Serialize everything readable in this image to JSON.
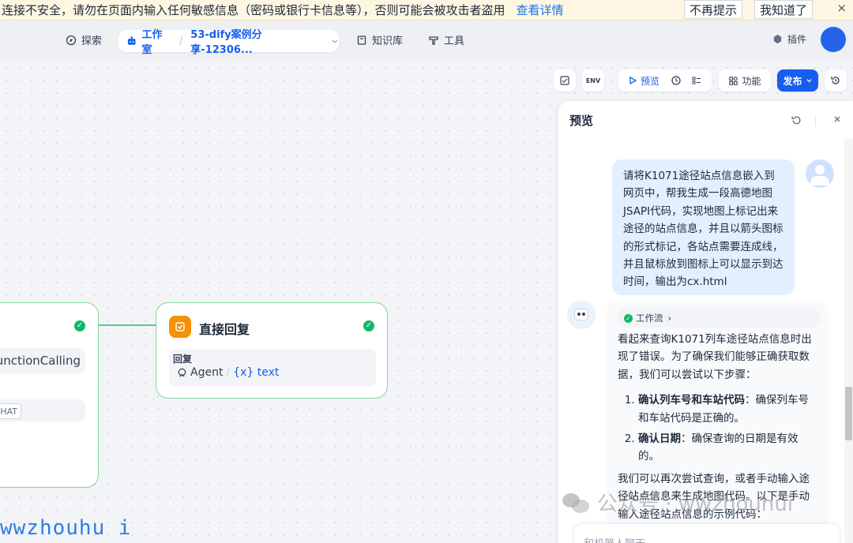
{
  "warning": {
    "text": "连接不安全，请勿在页面内输入任何敏感信息（密码或银行卡信息等），否则可能会被攻击者盗用",
    "link": "查看详情",
    "btn_no_remind": "不再提示",
    "btn_got_it": "我知道了",
    "close": "×"
  },
  "nav": {
    "explore": "探索",
    "studio": "工作室",
    "app_name": "53-dify案例分享-12306...",
    "knowledge": "知识库",
    "tools": "工具",
    "plugins": "插件"
  },
  "toolbar": {
    "preview": "预览",
    "features": "功能",
    "publish": "发布",
    "env": "ENV"
  },
  "nodes": {
    "left_pill": "unctionCalling",
    "left_tag": "HAT",
    "reply_title": "直接回复",
    "reply_label": "回复",
    "var_node": "Agent",
    "var_sep": "/",
    "var_name": "{x} text"
  },
  "preview": {
    "title": "预览",
    "user_message": "请将K1071途径站点信息嵌入到网页中，帮我生成一段高德地图JSAPI代码，实现地图上标记出来途径的站点信息，并且以箭头图标的形式标记，各站点需要连成线，并且鼠标放到图标上可以显示到达时间，输出为cx.html",
    "workflow_tag": "工作流",
    "bot_intro": "看起来查询K1071列车途径站点信息时出现了错误。为了确保我们能够正确获取数据，我们可以尝试以下步骤：",
    "steps": [
      {
        "bold": "确认列车号和车站代码",
        "rest": "：确保列车号和车站代码是正确的。"
      },
      {
        "bold": "确认日期",
        "rest": "：确保查询的日期是有效的。"
      }
    ],
    "bot_outro": "我们可以再次尝试查询，或者手动输入途径站点信息来生成地图代码。以下是手动输入途径站点信息的示例代码：",
    "input_placeholder": "和机器人聊天"
  },
  "watermark": {
    "left": "wwzhouhu i",
    "right": "公众号 · wwzhouhui"
  }
}
